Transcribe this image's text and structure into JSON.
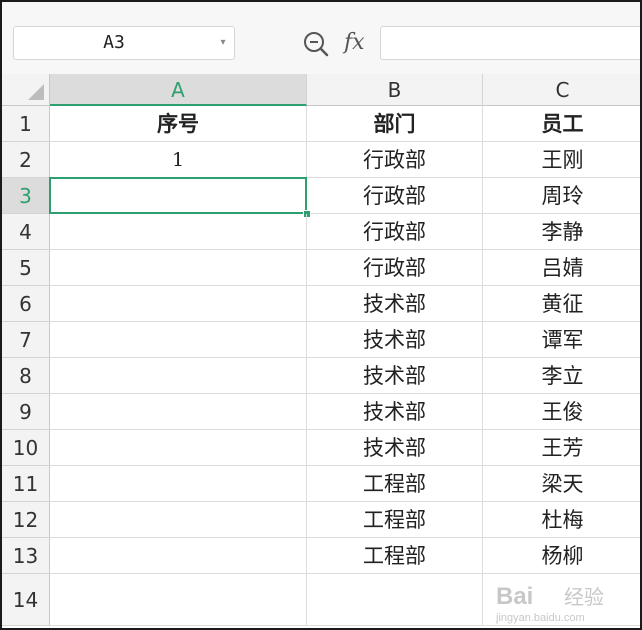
{
  "formula_bar": {
    "name_box_value": "A3",
    "zoom_icon": "zoom-icon",
    "fx_label": "fx",
    "formula_value": ""
  },
  "columns": [
    {
      "label": "A",
      "active": true
    },
    {
      "label": "B",
      "active": false
    },
    {
      "label": "C",
      "active": false
    }
  ],
  "rows": [
    {
      "num": "1",
      "cells": [
        "序号",
        "部门",
        "员工"
      ],
      "header": true
    },
    {
      "num": "2",
      "cells": [
        "1",
        "行政部",
        "王刚"
      ]
    },
    {
      "num": "3",
      "cells": [
        "",
        "行政部",
        "周玲"
      ],
      "active": true
    },
    {
      "num": "4",
      "cells": [
        "",
        "行政部",
        "李静"
      ]
    },
    {
      "num": "5",
      "cells": [
        "",
        "行政部",
        "吕婧"
      ]
    },
    {
      "num": "6",
      "cells": [
        "",
        "技术部",
        "黄征"
      ]
    },
    {
      "num": "7",
      "cells": [
        "",
        "技术部",
        "谭军"
      ]
    },
    {
      "num": "8",
      "cells": [
        "",
        "技术部",
        "李立"
      ]
    },
    {
      "num": "9",
      "cells": [
        "",
        "技术部",
        "王俊"
      ]
    },
    {
      "num": "10",
      "cells": [
        "",
        "技术部",
        "王芳"
      ]
    },
    {
      "num": "11",
      "cells": [
        "",
        "工程部",
        "梁天"
      ]
    },
    {
      "num": "12",
      "cells": [
        "",
        "工程部",
        "杜梅"
      ]
    },
    {
      "num": "13",
      "cells": [
        "",
        "工程部",
        "杨柳"
      ]
    },
    {
      "num": "14",
      "cells": [
        "",
        "",
        ""
      ]
    }
  ],
  "selected_cell": "A3",
  "colors": {
    "accent": "#2e9f6e",
    "header_bg": "#f3f3f3",
    "active_header_bg": "#dcdcdc",
    "gridline": "#dcdcdc"
  },
  "watermark": {
    "brand": "Bai",
    "brand_cn": "经验",
    "url": "jingyan.baidu.com"
  }
}
